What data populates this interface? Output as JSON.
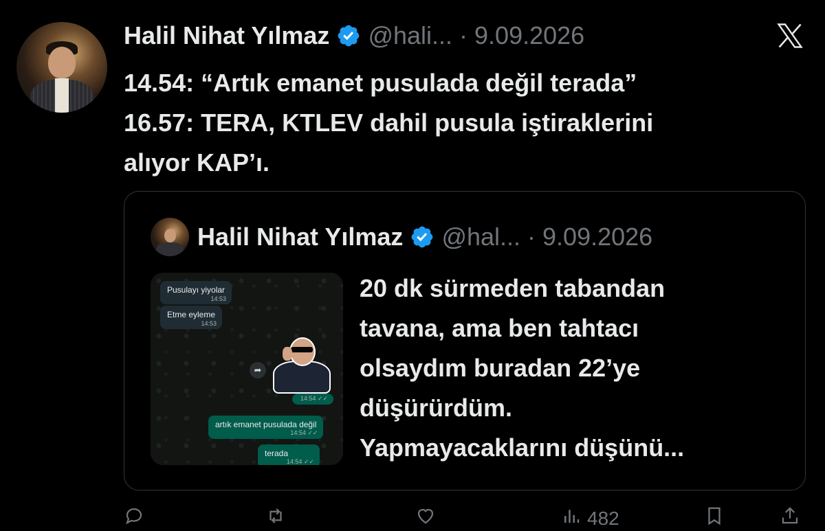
{
  "tweet": {
    "author_name": "Halil Nihat Yılmaz",
    "handle": "@hali...",
    "separator": "·",
    "date": "9.09.2026",
    "lines": [
      "14.54: “Artık emanet pusulada değil terada”",
      "16.57: TERA, KTLEV dahil pusula iştiraklerini",
      "alıyor KAP’ı."
    ]
  },
  "quote": {
    "author_name": "Halil Nihat Yılmaz",
    "handle": "@hal...",
    "separator": "·",
    "date": "9.09.2026",
    "lines": [
      "20 dk sürmeden tabandan",
      "tavana, ama ben tahtacı",
      "olsaydım buradan 22’ye",
      "düşürürdüm.",
      "Yapmayacaklarını düşünü..."
    ],
    "chat": {
      "messages": [
        {
          "text": "Pusulayı yiyolar",
          "time": "14:53",
          "dir": "in"
        },
        {
          "text": "Etme eyleme",
          "time": "14:53",
          "dir": "in"
        },
        {
          "text": "",
          "time": "14:54 ✓✓",
          "dir": "out"
        },
        {
          "text": "artık emanet pusulada değil",
          "time": "14:54 ✓✓",
          "dir": "out"
        },
        {
          "text": "terada",
          "time": "14:54 ✓✓",
          "dir": "out"
        }
      ]
    }
  },
  "actions": {
    "views_count": "482"
  },
  "colors": {
    "background": "#000000",
    "text": "#e7e9ea",
    "muted": "#71767b",
    "verified": "#1d9bf0",
    "border": "#333639"
  },
  "icons": [
    "verified-badge-icon",
    "x-logo-icon",
    "forward-icon",
    "reply-icon",
    "retweet-icon",
    "like-icon",
    "views-icon",
    "bookmark-icon",
    "share-icon"
  ]
}
